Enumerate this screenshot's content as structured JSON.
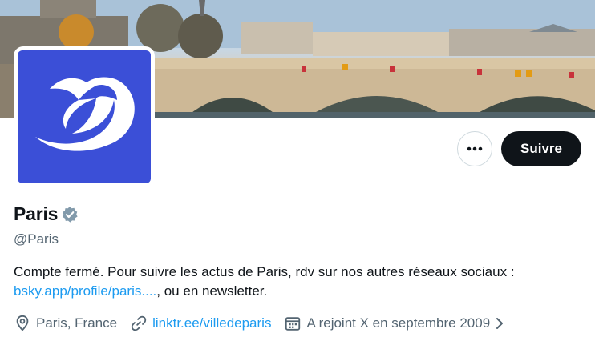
{
  "profile": {
    "name": "Paris",
    "handle": "@Paris",
    "bio_text": "Compte fermé. Pour suivre les actus de Paris, rdv sur nos autres réseaux sociaux :",
    "bio_link": "bsky.app/profile/paris....",
    "bio_suffix": ", ou en newsletter.",
    "location": "Paris, France",
    "website": "linktr.ee/villedeparis",
    "joined": "A rejoint X en septembre 2009"
  },
  "actions": {
    "follow_label": "Suivre"
  },
  "icons": {
    "more": "more-horizontal-icon",
    "verified": "verified-badge-icon",
    "location": "location-pin-icon",
    "link": "link-icon",
    "calendar": "calendar-icon",
    "chevron": "chevron-right-icon"
  },
  "colors": {
    "avatar_bg": "#3b4fd7",
    "link": "#1d9bf0",
    "follow_bg": "#0f1419",
    "secondary_text": "#536471",
    "verified_badge": "#829aab"
  }
}
